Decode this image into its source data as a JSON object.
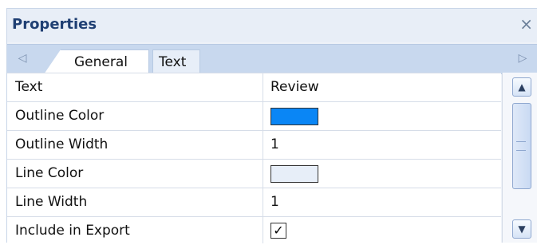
{
  "panel": {
    "title": "Properties",
    "close_icon": "close-icon"
  },
  "tabs": [
    {
      "label": "General",
      "active": true
    },
    {
      "label": "Text",
      "active": false
    }
  ],
  "navigation": {
    "left_icon": "chevron-left-icon",
    "right_icon": "chevron-right-icon"
  },
  "properties": [
    {
      "name": "Text",
      "value": "Review",
      "type": "text"
    },
    {
      "name": "Outline Color",
      "type": "color",
      "color": "#0a86f5"
    },
    {
      "name": "Outline Width",
      "value": "1",
      "type": "text"
    },
    {
      "name": "Line Color",
      "type": "color",
      "color": "#e7eef8"
    },
    {
      "name": "Line Width",
      "value": "1",
      "type": "text"
    },
    {
      "name": "Include in Export",
      "type": "checkbox",
      "checked": true
    }
  ],
  "scrollbar": {
    "up_icon": "scroll-up-icon",
    "down_icon": "scroll-down-icon"
  }
}
